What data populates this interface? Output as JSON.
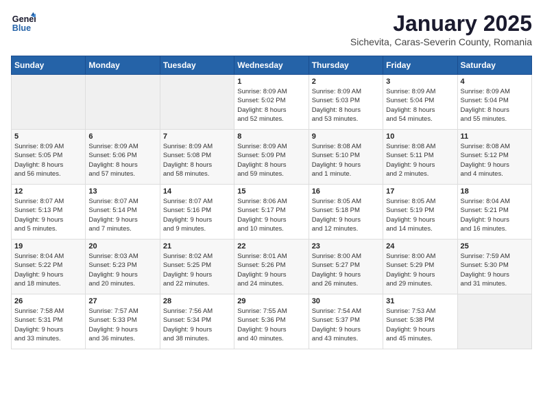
{
  "header": {
    "logo_line1": "General",
    "logo_line2": "Blue",
    "title": "January 2025",
    "subtitle": "Sichevita, Caras-Severin County, Romania"
  },
  "weekdays": [
    "Sunday",
    "Monday",
    "Tuesday",
    "Wednesday",
    "Thursday",
    "Friday",
    "Saturday"
  ],
  "weeks": [
    [
      {
        "day": "",
        "info": ""
      },
      {
        "day": "",
        "info": ""
      },
      {
        "day": "",
        "info": ""
      },
      {
        "day": "1",
        "info": "Sunrise: 8:09 AM\nSunset: 5:02 PM\nDaylight: 8 hours\nand 52 minutes."
      },
      {
        "day": "2",
        "info": "Sunrise: 8:09 AM\nSunset: 5:03 PM\nDaylight: 8 hours\nand 53 minutes."
      },
      {
        "day": "3",
        "info": "Sunrise: 8:09 AM\nSunset: 5:04 PM\nDaylight: 8 hours\nand 54 minutes."
      },
      {
        "day": "4",
        "info": "Sunrise: 8:09 AM\nSunset: 5:04 PM\nDaylight: 8 hours\nand 55 minutes."
      }
    ],
    [
      {
        "day": "5",
        "info": "Sunrise: 8:09 AM\nSunset: 5:05 PM\nDaylight: 8 hours\nand 56 minutes."
      },
      {
        "day": "6",
        "info": "Sunrise: 8:09 AM\nSunset: 5:06 PM\nDaylight: 8 hours\nand 57 minutes."
      },
      {
        "day": "7",
        "info": "Sunrise: 8:09 AM\nSunset: 5:08 PM\nDaylight: 8 hours\nand 58 minutes."
      },
      {
        "day": "8",
        "info": "Sunrise: 8:09 AM\nSunset: 5:09 PM\nDaylight: 8 hours\nand 59 minutes."
      },
      {
        "day": "9",
        "info": "Sunrise: 8:08 AM\nSunset: 5:10 PM\nDaylight: 9 hours\nand 1 minute."
      },
      {
        "day": "10",
        "info": "Sunrise: 8:08 AM\nSunset: 5:11 PM\nDaylight: 9 hours\nand 2 minutes."
      },
      {
        "day": "11",
        "info": "Sunrise: 8:08 AM\nSunset: 5:12 PM\nDaylight: 9 hours\nand 4 minutes."
      }
    ],
    [
      {
        "day": "12",
        "info": "Sunrise: 8:07 AM\nSunset: 5:13 PM\nDaylight: 9 hours\nand 5 minutes."
      },
      {
        "day": "13",
        "info": "Sunrise: 8:07 AM\nSunset: 5:14 PM\nDaylight: 9 hours\nand 7 minutes."
      },
      {
        "day": "14",
        "info": "Sunrise: 8:07 AM\nSunset: 5:16 PM\nDaylight: 9 hours\nand 9 minutes."
      },
      {
        "day": "15",
        "info": "Sunrise: 8:06 AM\nSunset: 5:17 PM\nDaylight: 9 hours\nand 10 minutes."
      },
      {
        "day": "16",
        "info": "Sunrise: 8:05 AM\nSunset: 5:18 PM\nDaylight: 9 hours\nand 12 minutes."
      },
      {
        "day": "17",
        "info": "Sunrise: 8:05 AM\nSunset: 5:19 PM\nDaylight: 9 hours\nand 14 minutes."
      },
      {
        "day": "18",
        "info": "Sunrise: 8:04 AM\nSunset: 5:21 PM\nDaylight: 9 hours\nand 16 minutes."
      }
    ],
    [
      {
        "day": "19",
        "info": "Sunrise: 8:04 AM\nSunset: 5:22 PM\nDaylight: 9 hours\nand 18 minutes."
      },
      {
        "day": "20",
        "info": "Sunrise: 8:03 AM\nSunset: 5:23 PM\nDaylight: 9 hours\nand 20 minutes."
      },
      {
        "day": "21",
        "info": "Sunrise: 8:02 AM\nSunset: 5:25 PM\nDaylight: 9 hours\nand 22 minutes."
      },
      {
        "day": "22",
        "info": "Sunrise: 8:01 AM\nSunset: 5:26 PM\nDaylight: 9 hours\nand 24 minutes."
      },
      {
        "day": "23",
        "info": "Sunrise: 8:00 AM\nSunset: 5:27 PM\nDaylight: 9 hours\nand 26 minutes."
      },
      {
        "day": "24",
        "info": "Sunrise: 8:00 AM\nSunset: 5:29 PM\nDaylight: 9 hours\nand 29 minutes."
      },
      {
        "day": "25",
        "info": "Sunrise: 7:59 AM\nSunset: 5:30 PM\nDaylight: 9 hours\nand 31 minutes."
      }
    ],
    [
      {
        "day": "26",
        "info": "Sunrise: 7:58 AM\nSunset: 5:31 PM\nDaylight: 9 hours\nand 33 minutes."
      },
      {
        "day": "27",
        "info": "Sunrise: 7:57 AM\nSunset: 5:33 PM\nDaylight: 9 hours\nand 36 minutes."
      },
      {
        "day": "28",
        "info": "Sunrise: 7:56 AM\nSunset: 5:34 PM\nDaylight: 9 hours\nand 38 minutes."
      },
      {
        "day": "29",
        "info": "Sunrise: 7:55 AM\nSunset: 5:36 PM\nDaylight: 9 hours\nand 40 minutes."
      },
      {
        "day": "30",
        "info": "Sunrise: 7:54 AM\nSunset: 5:37 PM\nDaylight: 9 hours\nand 43 minutes."
      },
      {
        "day": "31",
        "info": "Sunrise: 7:53 AM\nSunset: 5:38 PM\nDaylight: 9 hours\nand 45 minutes."
      },
      {
        "day": "",
        "info": ""
      }
    ]
  ]
}
